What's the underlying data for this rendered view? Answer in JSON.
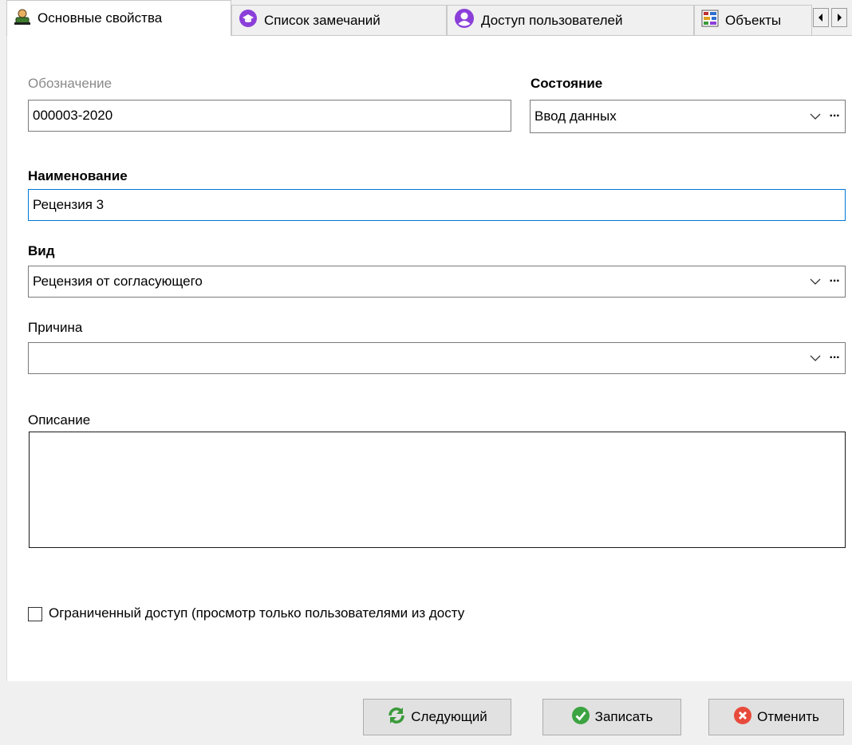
{
  "tabs": [
    {
      "label": "Основные свойства",
      "icon": "user-icon",
      "active": true
    },
    {
      "label": "Список замечаний",
      "icon": "cap-icon",
      "active": false
    },
    {
      "label": "Доступ пользователей",
      "icon": "person-icon",
      "active": false
    },
    {
      "label": "Объекты",
      "icon": "objects-icon",
      "active": false
    }
  ],
  "form": {
    "designation_label": "Обозначение",
    "designation_value": "000003-2020",
    "state_label": "Состояние",
    "state_value": "Ввод данных",
    "name_label": "Наименование",
    "name_value": "Рецензия 3",
    "kind_label": "Вид",
    "kind_value": "Рецензия от согласующего",
    "reason_label": "Причина",
    "reason_value": "",
    "description_label": "Описание",
    "description_value": "",
    "restricted_label": "Ограниченный доступ (просмотр только пользователями из досту",
    "restricted_checked": false,
    "dots": "···"
  },
  "buttons": {
    "next": "Следующий",
    "save": "Записать",
    "cancel": "Отменить"
  },
  "colors": {
    "focus_border": "#0078d7",
    "save_green": "#3ca441",
    "cancel_red": "#e84b3c",
    "tab_purple": "#8b3fd9"
  }
}
